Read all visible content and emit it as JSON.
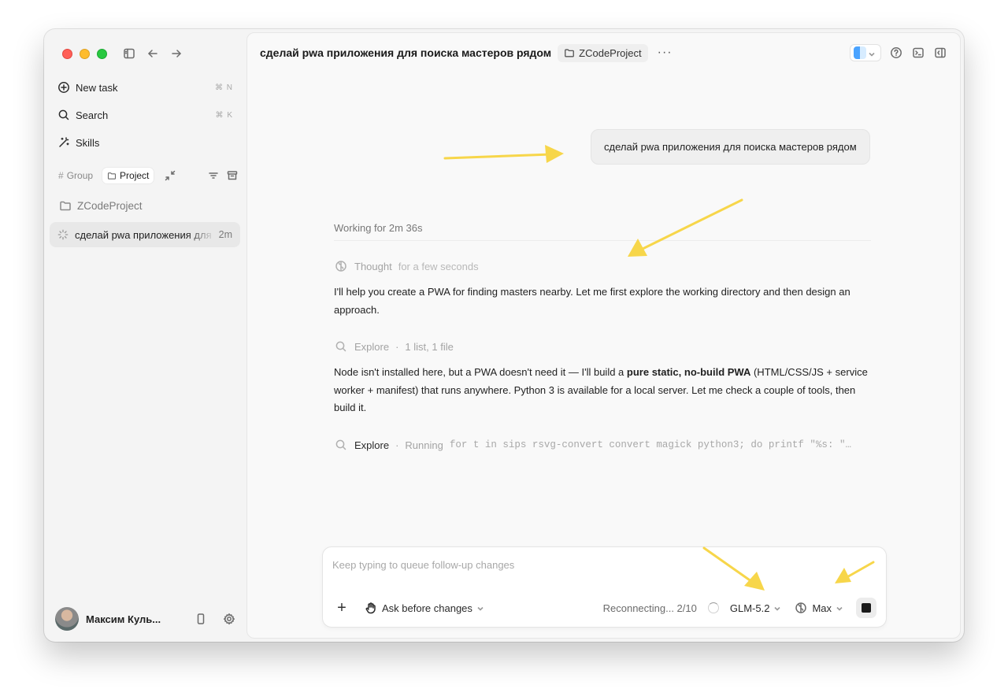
{
  "sidebar": {
    "new_task": {
      "label": "New task",
      "shortcut": "⌘ N"
    },
    "search": {
      "label": "Search",
      "shortcut": "⌘ K"
    },
    "skills": {
      "label": "Skills"
    },
    "filters": {
      "group": "Group",
      "project": "Project"
    },
    "folder": "ZCodeProject",
    "task": {
      "title": "сделай pwa приложения для поиска мастеров рядом",
      "time": "2m"
    },
    "user": {
      "name": "Максим Куль..."
    }
  },
  "header": {
    "title": "сделай pwa приложения для поиска мастеров рядом",
    "project": "ZCodeProject",
    "more": "···"
  },
  "chat": {
    "user_message": "сделай pwa приложения для поиска мастеров рядом",
    "working": "Working for 2m 36s",
    "thought": {
      "label": "Thought",
      "detail": "for a few seconds"
    },
    "para1": "I'll help you create a PWA for finding masters nearby. Let me first explore the working directory and then design an approach.",
    "explore1": {
      "label": "Explore",
      "detail": "1 list, 1 file"
    },
    "para2": {
      "before": "Node isn't installed here, but a PWA doesn't need it — I'll build a ",
      "bold": "pure static, no-build PWA",
      "after": " (HTML/CSS/JS + service worker + manifest) that runs anywhere. Python 3 is available for a local server. Let me check a couple of tools, then build it."
    },
    "explore2": {
      "label": "Explore",
      "status": "Running",
      "command": "for t in sips rsvg-convert convert magick python3; do printf \"%s: \"…"
    }
  },
  "composer": {
    "placeholder": "Keep typing to queue follow-up changes",
    "plus": "+",
    "ask_mode": "Ask before changes",
    "status": "Reconnecting... 2/10",
    "model": "GLM-5.2",
    "effort": "Max"
  },
  "colors": {
    "annotation_arrow": "#f7d64a",
    "red": "#ff5f57",
    "yellow": "#febc2e",
    "green": "#28c840"
  }
}
